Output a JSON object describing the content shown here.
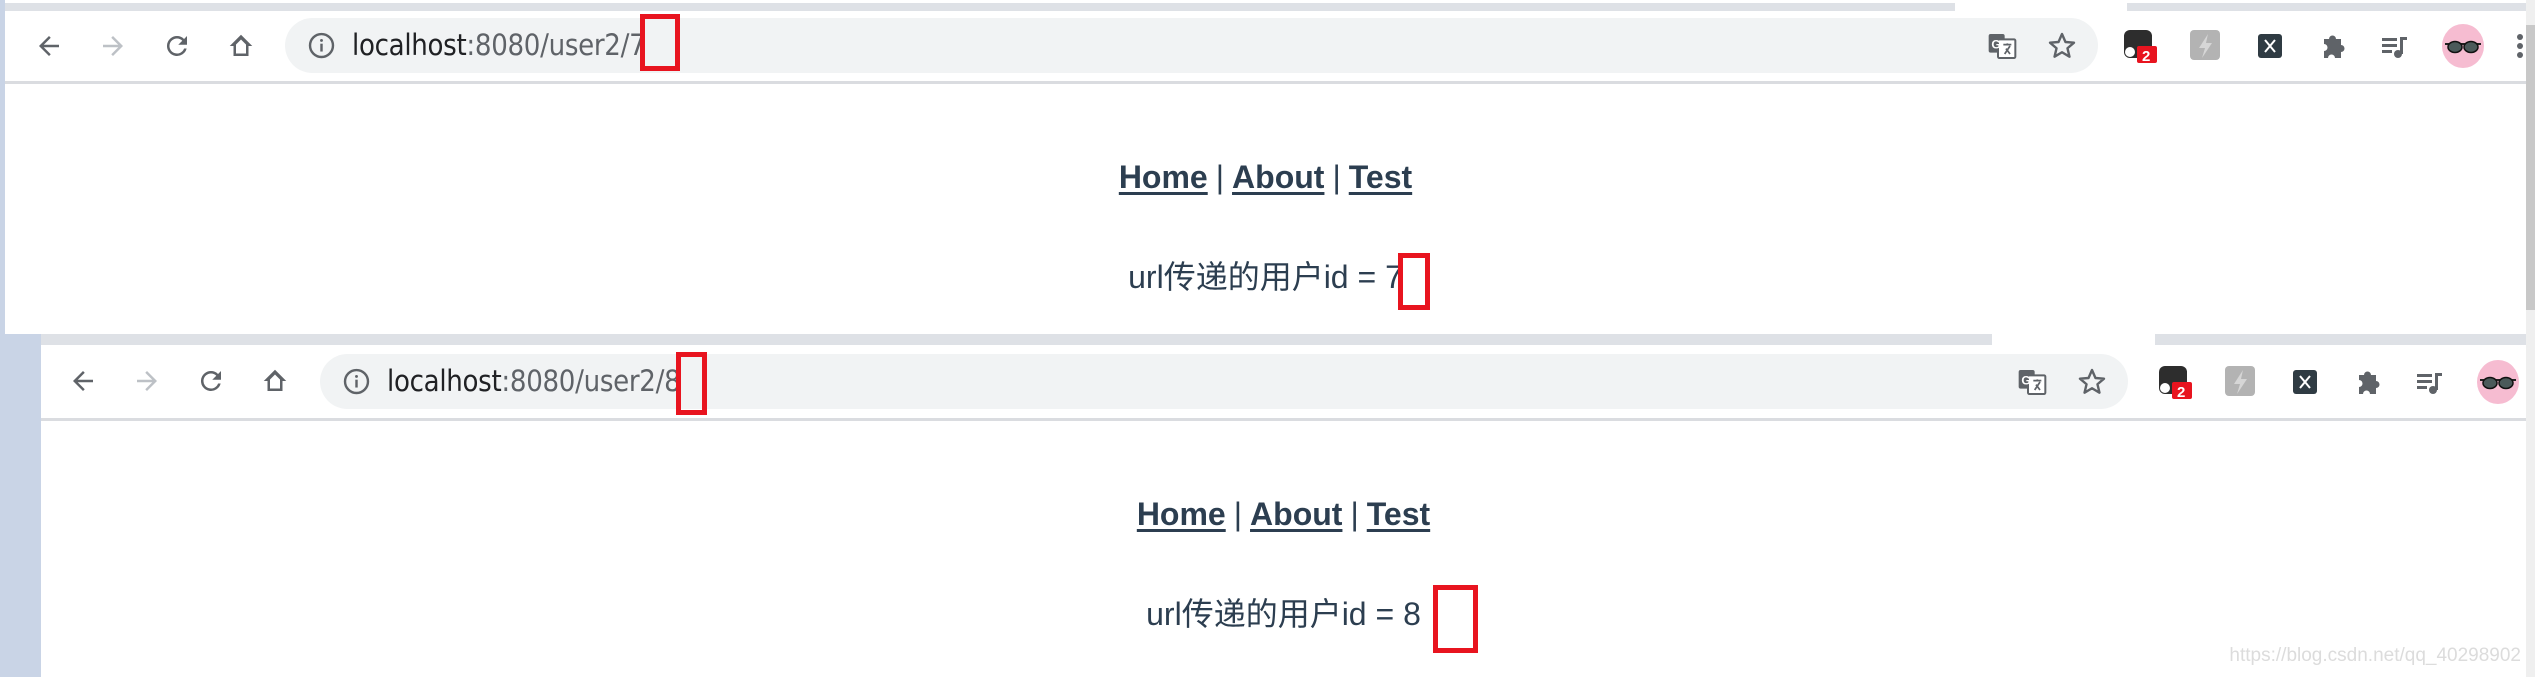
{
  "windows": [
    {
      "url": {
        "host": "localhost",
        "rest": ":8080/user2/",
        "id": "7"
      },
      "nav": {
        "home": "Home",
        "about": "About",
        "test": "Test",
        "separator": "|"
      },
      "content": {
        "label": "url传递的用户id = ",
        "value": "7"
      }
    },
    {
      "url": {
        "host": "localhost",
        "rest": ":8080/user2/",
        "id": "8"
      },
      "nav": {
        "home": "Home",
        "about": "About",
        "test": "Test",
        "separator": "|"
      },
      "content": {
        "label": "url传递的用户id = ",
        "value": "8"
      }
    }
  ],
  "toolbar": {
    "icons": [
      "back-icon",
      "forward-icon",
      "reload-icon",
      "home-icon",
      "site-info-icon",
      "translate-icon",
      "bookmark-star-icon"
    ],
    "extensions": [
      {
        "name": "extension-dark",
        "badge": "2"
      },
      {
        "name": "extension-lightning"
      },
      {
        "name": "extension-x"
      },
      {
        "name": "extensions-puzzle"
      },
      {
        "name": "media-queue"
      },
      {
        "name": "profile-avatar"
      },
      {
        "name": "menu-kebab"
      }
    ]
  },
  "colors": {
    "highlight": "#e8141f",
    "text": "#2c3e50",
    "badge": "#e8141f"
  },
  "watermark": "https://blog.csdn.net/qq_40298902"
}
